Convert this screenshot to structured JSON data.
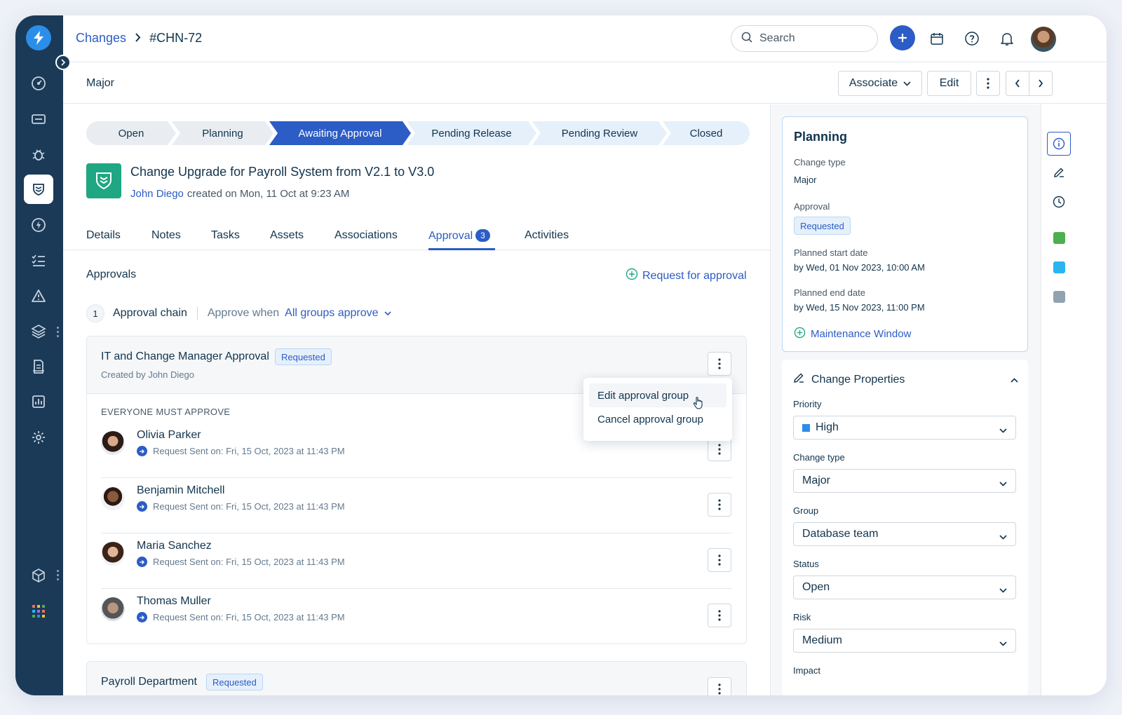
{
  "topbar": {
    "breadcrumb_parent": "Changes",
    "breadcrumb_current": "#CHN-72",
    "search_placeholder": "Search"
  },
  "subbar": {
    "title": "Major",
    "associate_label": "Associate",
    "edit_label": "Edit"
  },
  "stepper": [
    "Open",
    "Planning",
    "Awaiting Approval",
    "Pending Release",
    "Pending Review",
    "Closed"
  ],
  "change": {
    "title": "Change Upgrade for Payroll System from V2.1 to V3.0",
    "author": "John Diego",
    "created": "created on Mon, 11 Oct at 9:23 AM"
  },
  "tabs": {
    "details": "Details",
    "notes": "Notes",
    "tasks": "Tasks",
    "assets": "Assets",
    "associations": "Associations",
    "approval": "Approval",
    "approval_count": "3",
    "activities": "Activities"
  },
  "approvals": {
    "section_title": "Approvals",
    "request_link": "Request for approval",
    "chain_number": "1",
    "chain_label": "Approval chain",
    "approve_when": "Approve when",
    "approve_rule": "All groups approve",
    "group": {
      "name": "IT and Change Manager Approval",
      "status": "Requested",
      "created_by": "Created by John Diego",
      "rule": "EVERYONE MUST APPROVE"
    },
    "approvers": [
      {
        "name": "Olivia Parker",
        "sent": "Request Sent on: Fri, 15 Oct, 2023 at 11:43 PM"
      },
      {
        "name": "Benjamin Mitchell",
        "sent": "Request Sent on: Fri, 15 Oct, 2023 at 11:43 PM"
      },
      {
        "name": "Maria Sanchez",
        "sent": "Request Sent on: Fri, 15 Oct, 2023 at 11:43 PM"
      },
      {
        "name": "Thomas Muller",
        "sent": "Request Sent on: Fri, 15 Oct, 2023 at 11:43 PM"
      }
    ],
    "group2": {
      "name": "Payroll Department",
      "status": "Requested"
    },
    "menu": {
      "edit": "Edit approval group",
      "cancel": "Cancel approval group"
    }
  },
  "planning": {
    "title": "Planning",
    "change_type_label": "Change type",
    "change_type_value": "Major",
    "approval_label": "Approval",
    "approval_value": "Requested",
    "start_label": "Planned start date",
    "start_value": "by Wed, 01 Nov 2023, 10:00 AM",
    "end_label": "Planned end date",
    "end_value": "by Wed, 15 Nov 2023, 11:00 PM",
    "maintenance_link": "Maintenance Window"
  },
  "properties": {
    "title": "Change Properties",
    "priority_label": "Priority",
    "priority_value": "High",
    "change_type_label": "Change type",
    "change_type_value": "Major",
    "group_label": "Group",
    "group_value": "Database team",
    "status_label": "Status",
    "status_value": "Open",
    "risk_label": "Risk",
    "risk_value": "Medium",
    "impact_label": "Impact"
  },
  "colors": {
    "primary": "#2c5cc5",
    "sidebar": "#1b3a57",
    "change_icon": "#1ea782",
    "priority_high": "#2c8ee8",
    "rail_green": "#4caf50",
    "rail_cyan": "#2bb5f0",
    "rail_gray": "#92a2b1"
  },
  "icons": {
    "sidebar": [
      "dashboard-icon",
      "ticket-icon",
      "bug-icon",
      "change-icon",
      "release-icon",
      "tasks-icon",
      "alert-icon",
      "layers-icon",
      "document-icon",
      "reports-icon",
      "settings-icon",
      "box-icon",
      "apps-grid-icon"
    ]
  }
}
